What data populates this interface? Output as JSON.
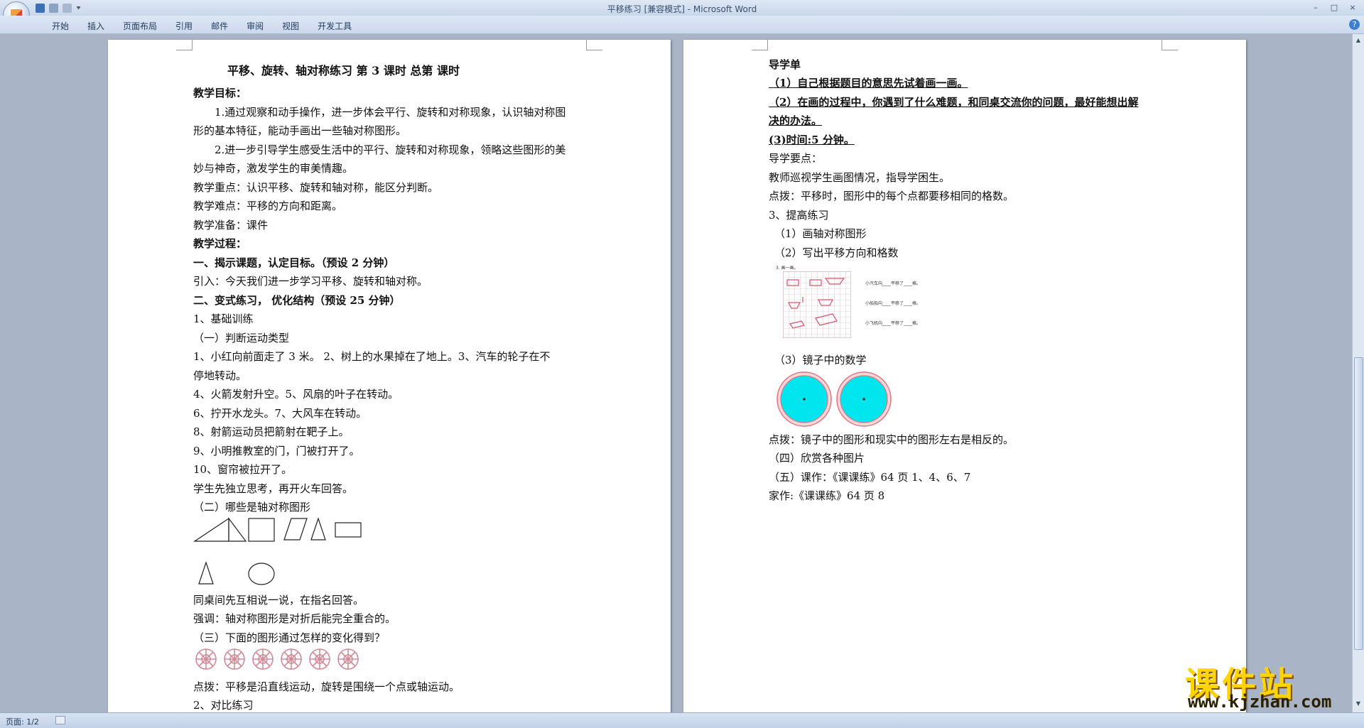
{
  "window": {
    "title": "平移练习 [兼容模式] - Microsoft Word",
    "controls": [
      "–",
      "□",
      "×"
    ]
  },
  "ribbon": {
    "tabs": [
      "开始",
      "插入",
      "页面布局",
      "引用",
      "邮件",
      "审阅",
      "视图",
      "开发工具"
    ]
  },
  "status": {
    "page": "页面: 1/2"
  },
  "page1": {
    "title": "平移、旋转、轴对称练习    第  3  课时     总第      课时",
    "lines": [
      "教学目标：",
      "1.通过观察和动手操作，进一步体会平行、旋转和对称现象，认识轴对称图",
      "形的基本特征，能动手画出一些轴对称图形。",
      "2.进一步引导学生感受生活中的平行、旋转和对称现象，领略这些图形的美",
      "妙与神奇，激发学生的审美情趣。",
      "教学重点：认识平移、旋转和轴对称，能区分判断。",
      "教学难点：平移的方向和距离。",
      "教学准备：课件",
      "教学过程：",
      "一、揭示课题，认定目标。（预设 2 分钟）",
      "引入：今天我们进一步学习平移、旋转和轴对称。",
      "二、变式练习， 优化结构（预设 25 分钟）",
      "1、基础训练",
      "（一）判断运动类型",
      "1、小红向前面走了 3 米。      2、树上的水果掉在了地上。3、汽车的轮子在不",
      "停地转动。",
      "4、火箭发射升空。5、风扇的叶子在转动。",
      "6、拧开水龙头。7、大风车在转动。",
      "8、射箭运动员把箭射在靶子上。",
      "9、小明推教室的门，门被打开了。",
      "10、窗帘被拉开了。",
      "学生先独立思考，再开火车回答。",
      "（二）哪些是轴对称图形",
      "同桌间先互相说一说，在指名回答。",
      "强调：轴对称图形是对折后能完全重合的。",
      "（三）下面的图形通过怎样的变化得到？",
      "点拨：平移是沿直线运动，旋转是围绕一个点或轴运动。",
      "2、对比练习"
    ]
  },
  "page2": {
    "lines": [
      "导学单",
      "（1）自己根据题目的意思先试着画一画。",
      "（2）在画的过程中，你遇到了什么难题，和同桌交流你的问题，最好能想出解",
      "决的办法。",
      "(3)时间:5 分钟。",
      "导学要点：",
      "教师巡视学生画图情况，指导学困生。",
      "点拨：平移时，图形中的每个点都要移相同的格数。",
      "3、提高练习",
      "（1）画轴对称图形",
      "（2）写出平移方向和格数",
      "（3）镜子中的数学",
      "点拨：镜子中的图形和现实中的图形左右是相反的。",
      "（四）欣赏各种图片",
      "（五）课作：《课课练》64 页 1、4、6、7",
      "家作:《课课练》64 页 8"
    ],
    "grid_caption": "3. 画一画。",
    "grid_rows": [
      "小汽车向____平移了____格。",
      "小船船向____平移了____格。",
      "小飞机向____平移了____格。"
    ]
  },
  "watermark": {
    "title": "课件站",
    "url": "www.kjzhan.com"
  },
  "colors": {
    "accent": "#ffd400",
    "clock": "#00e5ee",
    "rim": "#e8707a"
  }
}
